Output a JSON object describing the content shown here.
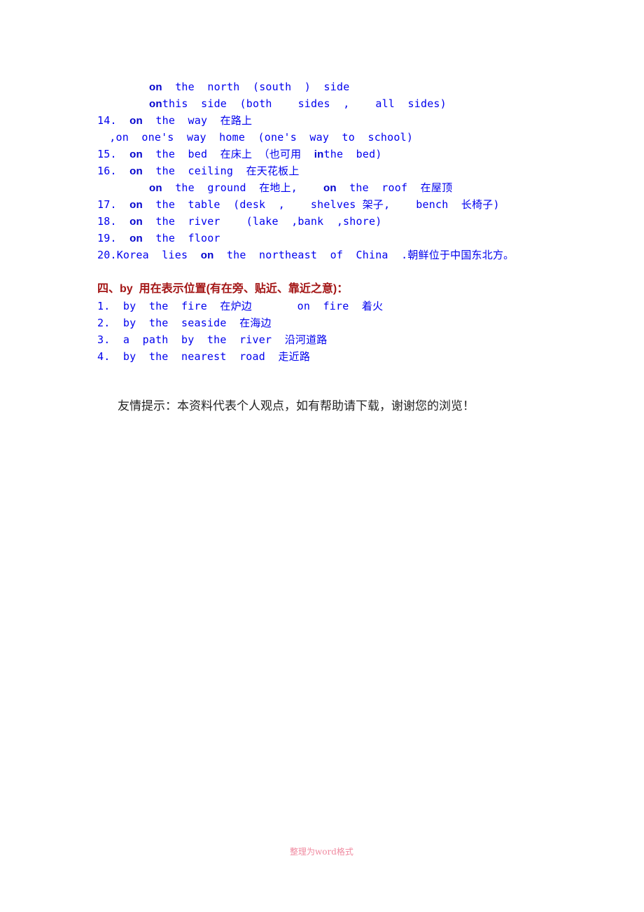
{
  "section3": {
    "lines": [
      {
        "pre": "",
        "kw": "on",
        "post": "  the  north  (south  )  side"
      },
      {
        "pre": "",
        "kw": "on",
        "post": "this  side  (both    sides  ,    all  sides)"
      },
      {
        "pre": "14.  ",
        "kw": "on",
        "post": "  the  way  在路上"
      },
      {
        "pre": " ,on  one's  way  home  (one's  way  to  school)",
        "kw": "",
        "post": ""
      },
      {
        "pre": "15.  ",
        "kw": "on",
        "post": "  the  bed  在床上 （也可用  "
      },
      {
        "pre": "16.  ",
        "kw": "on",
        "post": "  the  ceiling  在天花板上"
      },
      {
        "pre": "",
        "kw": "on",
        "post": "  the  ground  在地上,    "
      },
      {
        "pre": "17.  ",
        "kw": "on",
        "post": "  the  table  (desk  ,    shelves 架子,    bench  长椅子)"
      },
      {
        "pre": "18.  ",
        "kw": "on",
        "post": "  the  river    (lake  ,bank  ,shore)"
      },
      {
        "pre": "19.  ",
        "kw": "on",
        "post": "  the  floor"
      },
      {
        "pre": "20.Korea  lies  ",
        "kw": "on",
        "post": "  the  northeast  of  China  .朝鲜位于中国东北方。"
      }
    ],
    "line15_tail": {
      "kw": "in",
      "post": "the  bed)"
    },
    "line_ground_tail": {
      "kw": "on",
      "post": "  the  roof  在屋顶"
    }
  },
  "section4": {
    "heading": "四、by  用在表示位置(有在旁、贴近、靠近之意)：",
    "items": [
      "1.  by  the  fire  在炉边       on  fire  着火",
      "2.  by  the  seaside  在海边",
      "3.  a  path  by  the  river  沿河道路",
      "4.  by  the  nearest  road  走近路"
    ]
  },
  "tip": "友情提示：本资料代表个人观点，如有帮助请下载，谢谢您的浏览！",
  "footer": "整理为word格式"
}
